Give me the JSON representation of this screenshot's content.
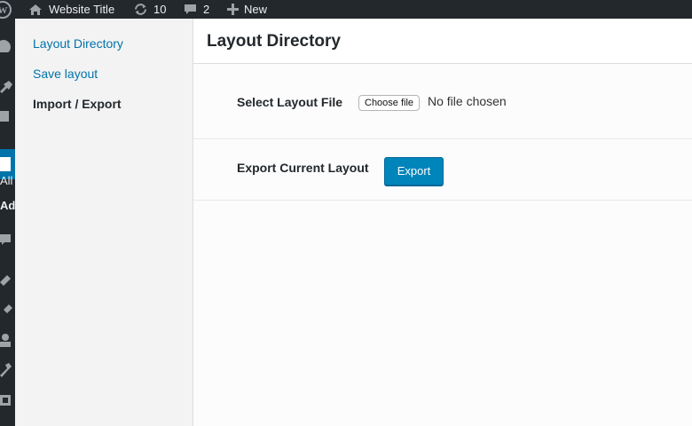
{
  "admin_bar": {
    "site_title": "Website Title",
    "updates_count": "10",
    "comments_count": "2",
    "new_label": "New"
  },
  "admin_menu": {
    "partial_text_1": "All",
    "partial_text_2": "Ad"
  },
  "sidebar": {
    "items": [
      {
        "label": "Layout Directory"
      },
      {
        "label": "Save layout"
      },
      {
        "label": "Import / Export"
      }
    ]
  },
  "header": {
    "title": "Layout Directory"
  },
  "import_row": {
    "label": "Select Layout File",
    "choose_button": "Choose file",
    "status_text": "No file chosen"
  },
  "export_row": {
    "label": "Export Current Layout",
    "button": "Export"
  },
  "colors": {
    "admin_bar_bg": "#23282d",
    "link_blue": "#0073aa",
    "primary_button": "#0085ba"
  }
}
